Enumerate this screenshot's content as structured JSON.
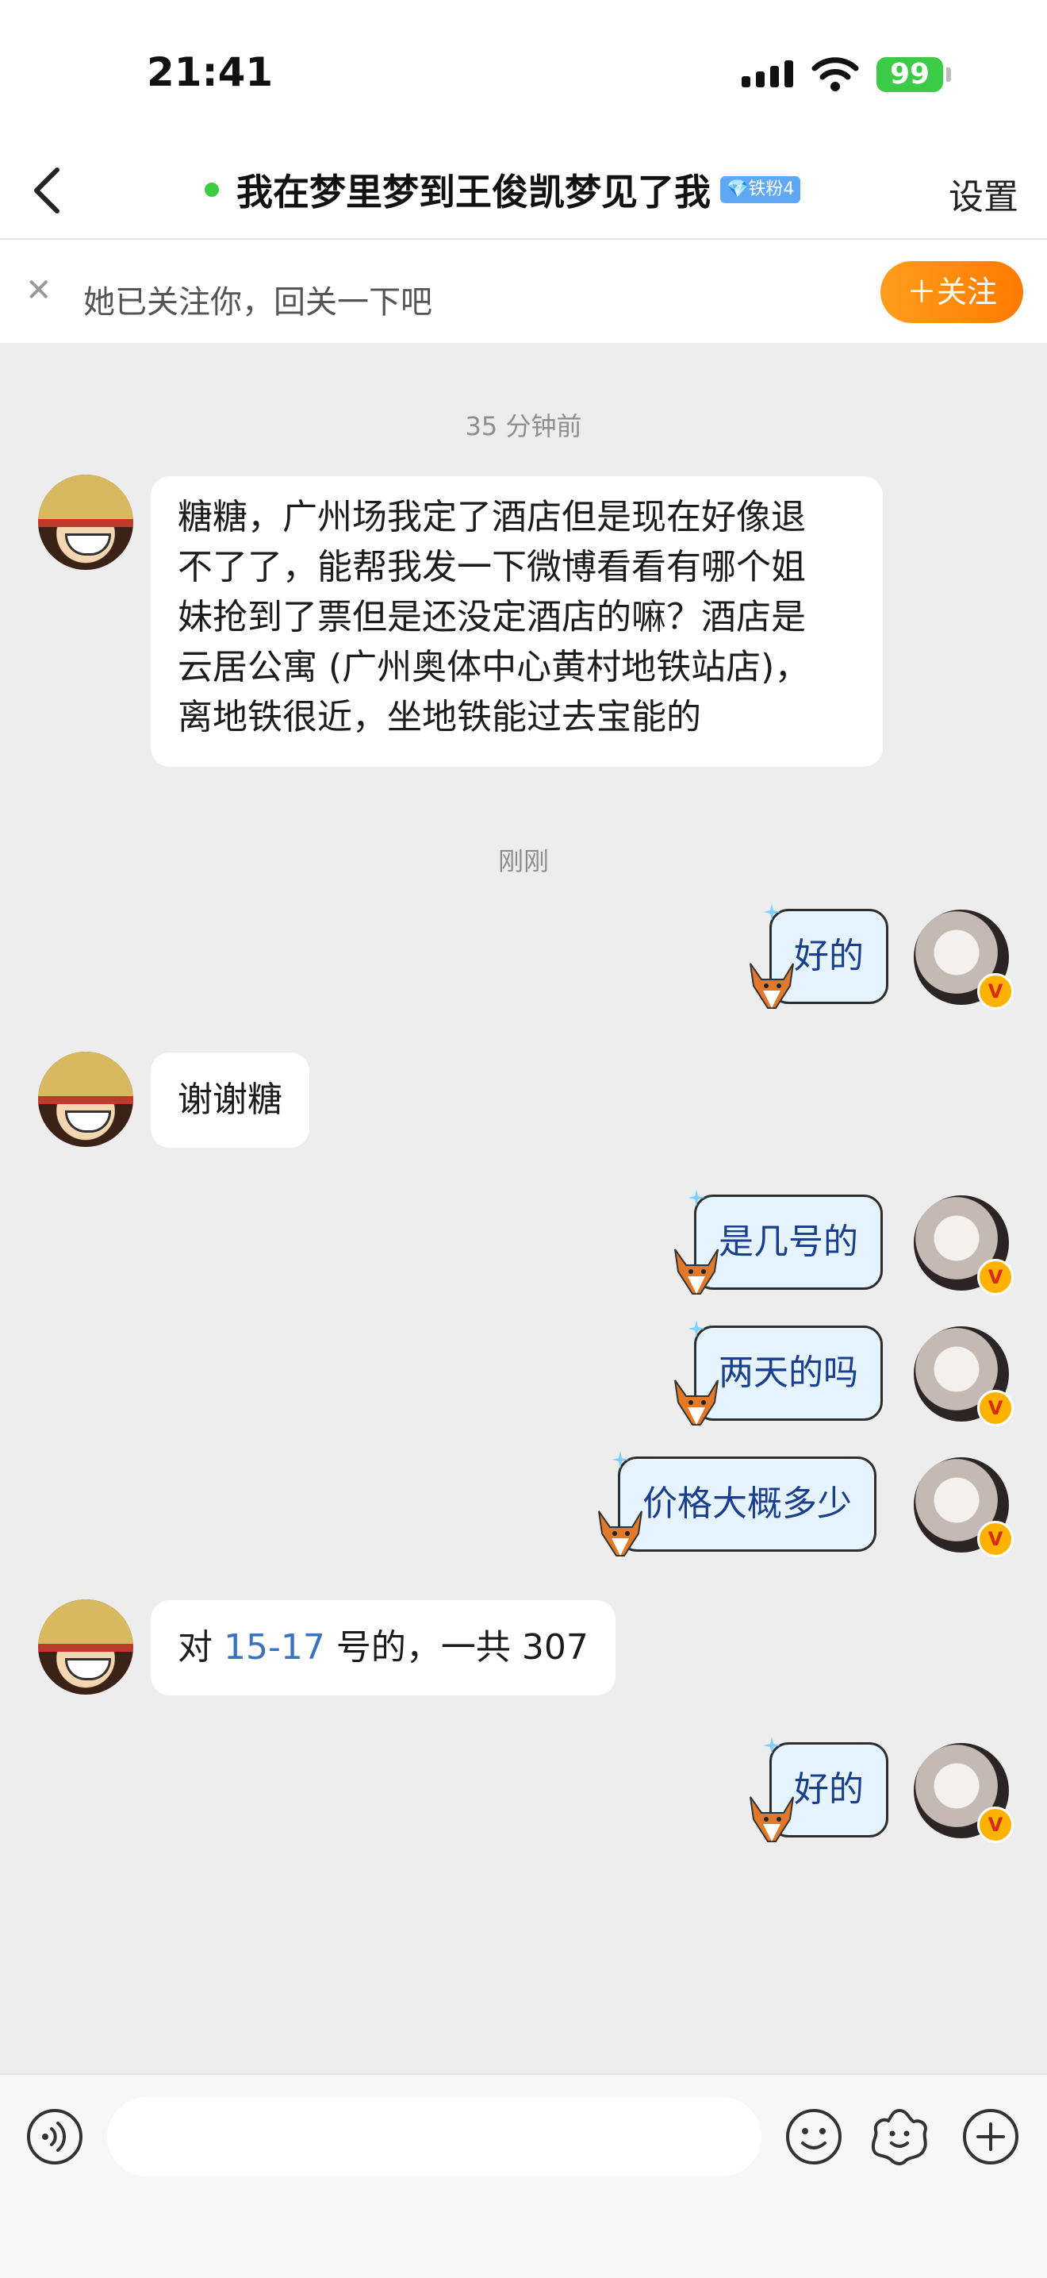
{
  "status_bar": {
    "time": "21:41",
    "battery": "99"
  },
  "header": {
    "title": "我在梦里梦到王俊凯梦见了我",
    "badge": "💎铁粉4",
    "settings_label": "设置"
  },
  "follow_prompt": {
    "text": "她已关注你，回关一下吧",
    "button_label": "＋关注"
  },
  "messages": [
    {
      "timestamp": "35 分钟前"
    },
    {
      "side": "left",
      "lines": [
        "糖糖，广州场我定了酒店但是现在好像退",
        "不了了，能帮我发一下微博看看有哪个姐",
        "妹抢到了票但是还没定酒店的嘛？酒店是",
        "云居公寓 (广州奥体中心黄村地铁站店)，",
        "离地铁很近，坐地铁能过去宝能的"
      ]
    },
    {
      "timestamp": "刚刚"
    },
    {
      "side": "right",
      "text": "好的"
    },
    {
      "side": "left",
      "text": "谢谢糖"
    },
    {
      "side": "right",
      "text": "是几号的"
    },
    {
      "side": "right",
      "text": "两天的吗"
    },
    {
      "side": "right",
      "text": "价格大概多少"
    },
    {
      "side": "left",
      "prefix": "对 ",
      "highlight": "15-17",
      "suffix": " 号的，一共 307"
    },
    {
      "side": "right",
      "text": "好的"
    }
  ],
  "input": {
    "placeholder": ""
  },
  "icons": [
    "back-arrow-icon",
    "close-icon",
    "voice-icon",
    "emoji-icon",
    "sticker-icon",
    "plus-icon",
    "verified-icon",
    "fox-sticker-icon"
  ],
  "colors": {
    "online": "#3fcb41",
    "follow_button": "#ff8a0d",
    "sent_bubble": "#e6f4ff",
    "sent_text": "#1a3e8f",
    "link": "#3b73c0"
  }
}
